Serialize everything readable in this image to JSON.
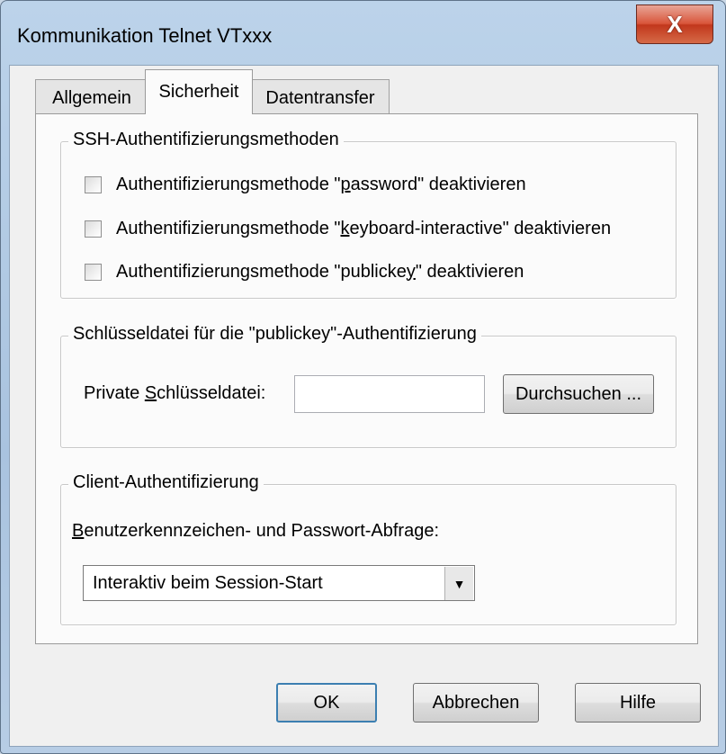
{
  "window": {
    "title": "Kommunikation Telnet VTxxx",
    "close_glyph": "X"
  },
  "tabs": [
    {
      "label": "Allgemein"
    },
    {
      "label": "Sicherheit"
    },
    {
      "label": "Datentransfer"
    }
  ],
  "ssh_group": {
    "label": "SSH-Authentifizierungsmethoden",
    "options": [
      {
        "pre": "Authentifizierungsmethode \"",
        "hot": "p",
        "post": "assword\" deaktivieren",
        "checked": false
      },
      {
        "pre": "Authentifizierungsmethode \"",
        "hot": "k",
        "post": "eyboard-interactive\" deaktivieren",
        "checked": false
      },
      {
        "pre": "Authentifizierungsmethode \"publicke",
        "hot": "y",
        "post": "\" deaktivieren",
        "checked": false
      }
    ]
  },
  "key_group": {
    "label": "Schlüsseldatei für die \"publickey\"-Authentifizierung",
    "field_label_pre": "Private ",
    "field_label_hot": "S",
    "field_label_post": "chlüsseldatei:",
    "field_value": "",
    "browse_label": "Durchsuchen ..."
  },
  "client_group": {
    "label": "Client-Authentifizierung",
    "prompt_hot": "B",
    "prompt_post": "enutzerkennzeichen- und Passwort-Abfrage:",
    "selected": "Interaktiv beim Session-Start"
  },
  "buttons": {
    "ok": "OK",
    "cancel": "Abbrechen",
    "help": "Hilfe"
  }
}
